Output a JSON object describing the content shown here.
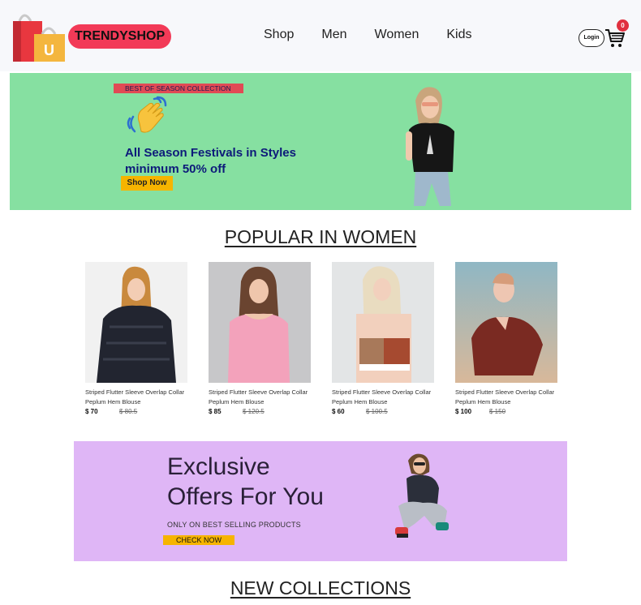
{
  "header": {
    "brand": "TRENDYSHOP",
    "logo_letter": "U",
    "nav": [
      "Shop",
      "Men",
      "Women",
      "Kids"
    ],
    "login_label": "Login",
    "cart_count": "0"
  },
  "hero": {
    "tag": "BEST OF SEASON COLLECTION",
    "title_line1": "All Season Festivals in Styles",
    "title_line2": "minimum 50% off",
    "button": "Shop Now",
    "bg_color": "#86e0a1"
  },
  "popular": {
    "title": "POPULAR IN WOMEN",
    "products": [
      {
        "name": "Striped Flutter Sleeve Overlap Collar Peplum Hem Blouse",
        "price": "$ 70",
        "old_price": "$ 80.5"
      },
      {
        "name": "Striped Flutter Sleeve Overlap Collar Peplum Hem Blouse",
        "price": "$ 85",
        "old_price": "$ 120.5"
      },
      {
        "name": "Striped Flutter Sleeve Overlap Collar Peplum Hem Blouse",
        "price": "$ 60",
        "old_price": "$ 100.5"
      },
      {
        "name": "Striped Flutter Sleeve Overlap Collar Peplum Hem Blouse",
        "price": "$ 100",
        "old_price": "$ 150"
      }
    ]
  },
  "offer": {
    "title_line1": "Exclusive",
    "title_line2": "Offers For You",
    "subtitle": "ONLY ON BEST SELLING PRODUCTS",
    "button": "CHECK NOW",
    "bg_color": "#dfb6f6"
  },
  "new_collections": {
    "title": "NEW COLLECTIONS"
  }
}
